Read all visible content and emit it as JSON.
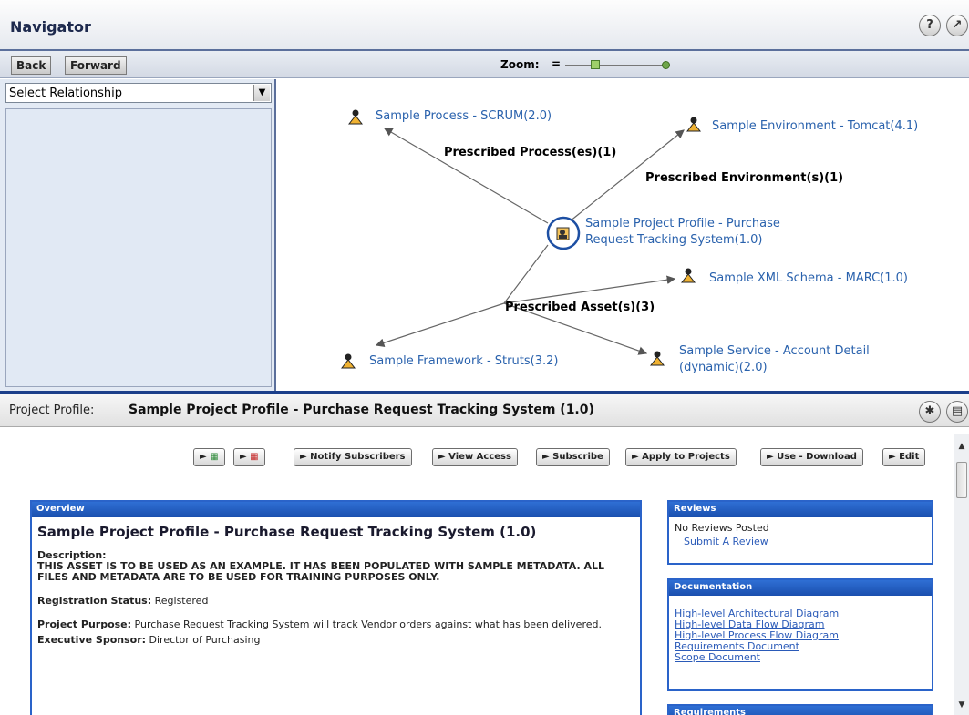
{
  "navigator": {
    "title": "Navigator",
    "back_label": "Back",
    "forward_label": "Forward",
    "zoom_label": "Zoom:",
    "zoom_minus": "=",
    "relationship_select": "Select Relationship",
    "center_node": [
      "Sample Project Profile - Purchase",
      "Request Tracking System(1.0)"
    ],
    "nodes": {
      "process": "Sample Process - SCRUM(2.0)",
      "environment": "Sample Environment - Tomcat(4.1)",
      "xml_schema": "Sample XML Schema - MARC(1.0)",
      "framework": "Sample Framework - Struts(3.2)",
      "service": [
        "Sample Service - Account Detail",
        "(dynamic)(2.0)"
      ]
    },
    "edges": {
      "process": "Prescribed Process(es)(1)",
      "environment": "Prescribed Environment(s)(1)",
      "assets": "Prescribed Asset(s)(3)"
    }
  },
  "detail": {
    "prefix": "Project Profile:",
    "name": "Sample Project Profile - Purchase Request Tracking System (1.0)",
    "actions": [
      "Notify Subscribers",
      "View Access",
      "Subscribe",
      "Apply to Projects",
      "Use - Download",
      "Edit"
    ],
    "overview": {
      "header": "Overview",
      "title": "Sample Project Profile - Purchase Request Tracking System (1.0)",
      "description_label": "Description:",
      "description": "THIS ASSET IS TO BE USED AS AN EXAMPLE. IT HAS BEEN POPULATED WITH SAMPLE METADATA. ALL FILES AND METADATA ARE TO BE USED FOR TRAINING PURPOSES ONLY.",
      "registration_label": "Registration Status:",
      "registration_value": "Registered",
      "purpose_label": "Project Purpose:",
      "purpose_value": "Purchase Request Tracking System will track Vendor orders against what has been delivered.",
      "sponsor_label": "Executive Sponsor:",
      "sponsor_value": "Director of Purchasing"
    },
    "reviews": {
      "header": "Reviews",
      "none": "No Reviews Posted",
      "submit": "Submit A Review"
    },
    "documentation": {
      "header": "Documentation",
      "links": [
        "High-level Architectural Diagram",
        "High-level Data Flow Diagram",
        "High-level Process Flow Diagram",
        "Requirements Document",
        "Scope Document"
      ]
    },
    "requirements": {
      "header": "Requirements"
    }
  },
  "colors": {
    "accent": "#2a63c9",
    "link": "#2a62ad",
    "divider": "#1b3f8a"
  }
}
